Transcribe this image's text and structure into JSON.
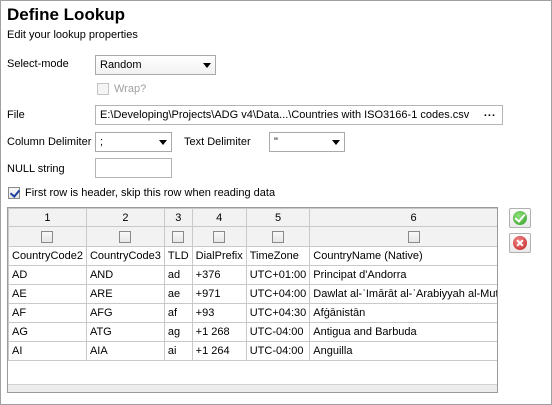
{
  "header": {
    "title": "Define Lookup",
    "subtitle": "Edit your lookup properties"
  },
  "form": {
    "select_mode_label": "Select-mode",
    "select_mode_value": "Random",
    "wrap_label": "Wrap?",
    "wrap_checked": false,
    "file_label": "File",
    "file_value": "E:\\Developing\\Projects\\ADG v4\\Data...\\Countries with ISO3166-1 codes.csv",
    "browse_label": "...",
    "column_delimiter_label": "Column Delimiter",
    "column_delimiter_value": ";",
    "text_delimiter_label": "Text Delimiter",
    "text_delimiter_value": "\"",
    "null_string_label": "NULL string",
    "null_string_value": "",
    "first_row_header_label": "First row is header, skip this row when reading data",
    "first_row_header_checked": true
  },
  "grid": {
    "column_numbers": [
      "1",
      "2",
      "3",
      "4",
      "5",
      "6"
    ],
    "headers": [
      "CountryCode2",
      "CountryCode3",
      "TLD",
      "DialPrefix",
      "TimeZone",
      "CountryName (Native)"
    ],
    "rows": [
      [
        "AD",
        "AND",
        "ad",
        "+376",
        "UTC+01:00",
        "Principat d'Andorra"
      ],
      [
        "AE",
        "ARE",
        "ae",
        "+971",
        "UTC+04:00",
        "Dawlat al-ʾImārāt al-ʿArabiyyah al-Muttah"
      ],
      [
        "AF",
        "AFG",
        "af",
        "+93",
        "UTC+04:30",
        "Afġānistān"
      ],
      [
        "AG",
        "ATG",
        "ag",
        "+1 268",
        "UTC-04:00",
        "Antigua and Barbuda"
      ],
      [
        "AI",
        "AIA",
        "ai",
        "+1 264",
        "UTC-04:00",
        "Anguilla"
      ]
    ]
  },
  "actions": {
    "ok_icon": "check-icon",
    "cancel_icon": "close-icon"
  }
}
